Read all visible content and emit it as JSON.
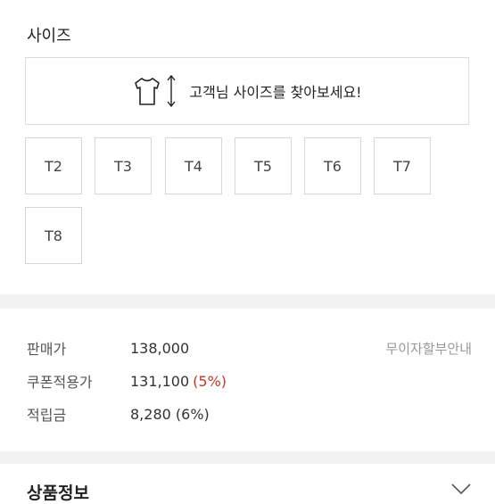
{
  "size_section": {
    "title": "사이즈",
    "finder_label": "고객님 사이즈를 찾아보세요!",
    "finder_icons": [
      "tshirt-icon",
      "vertical-arrows-icon"
    ],
    "options": [
      "T2",
      "T3",
      "T4",
      "T5",
      "T6",
      "T7",
      "T8"
    ]
  },
  "pricing": {
    "sale_label": "판매가",
    "sale_price": "138,000",
    "installment_link": "무이자할부안내",
    "coupon_label": "쿠폰적용가",
    "coupon_price": "131,100",
    "coupon_discount": "(5%)",
    "points_label": "적립금",
    "points_value": "8,280 (6%)"
  },
  "product_info": {
    "title": "상품정보",
    "toggle_icon": "chevron-down-icon"
  },
  "colors": {
    "discount": "#c0392b",
    "separator": "#f2f2f2",
    "border": "#d6d6d6"
  }
}
